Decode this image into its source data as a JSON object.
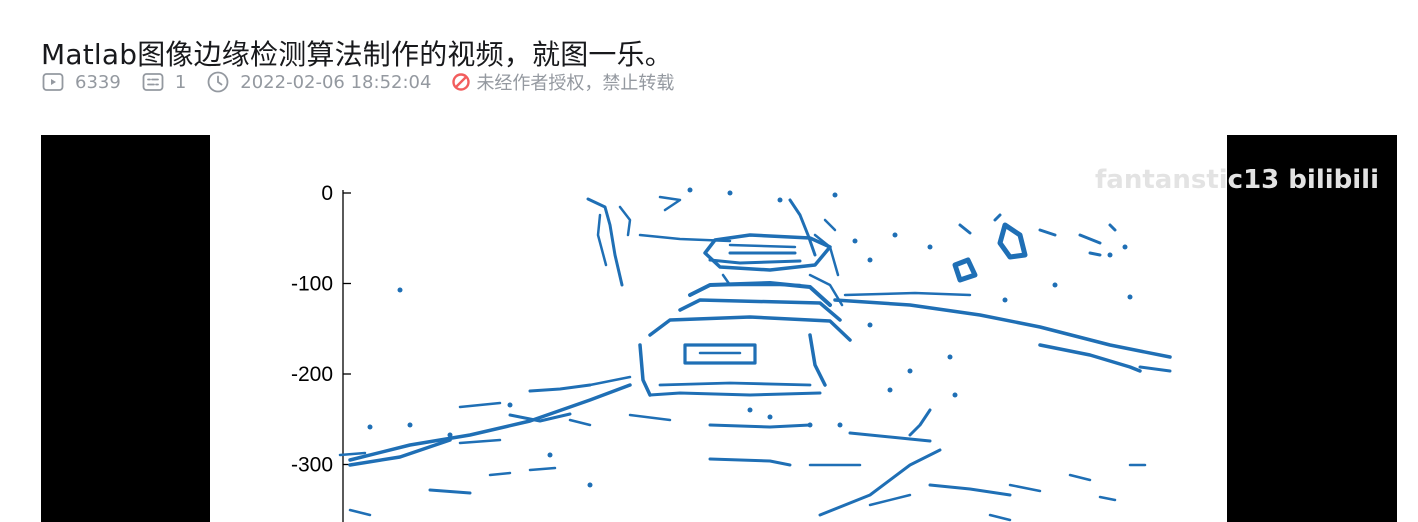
{
  "video": {
    "title": "Matlab图像边缘检测算法制作的视频，就图一乐。",
    "stats": {
      "plays": "6339",
      "danmaku": "1",
      "datetime": "2022-02-06 18:52:04",
      "copyright": "未经作者授权，禁止转载"
    },
    "watermark": "fantanstic13 bilibili"
  },
  "icons": {
    "plays": "play-count-icon",
    "danmaku": "danmaku-icon",
    "datetime": "clock-icon",
    "copyright": "forbidden-icon"
  },
  "colors": {
    "edge": "#1f6fb5",
    "axis": "#000000",
    "warn": "#f25d5d",
    "meta_text": "#9499a0",
    "letterbox": "#000000"
  },
  "chart_data": {
    "type": "scatter",
    "yticks": [
      "0",
      "-100",
      "-200",
      "-300"
    ],
    "y_values": [
      0,
      -100,
      -200,
      -300
    ]
  }
}
